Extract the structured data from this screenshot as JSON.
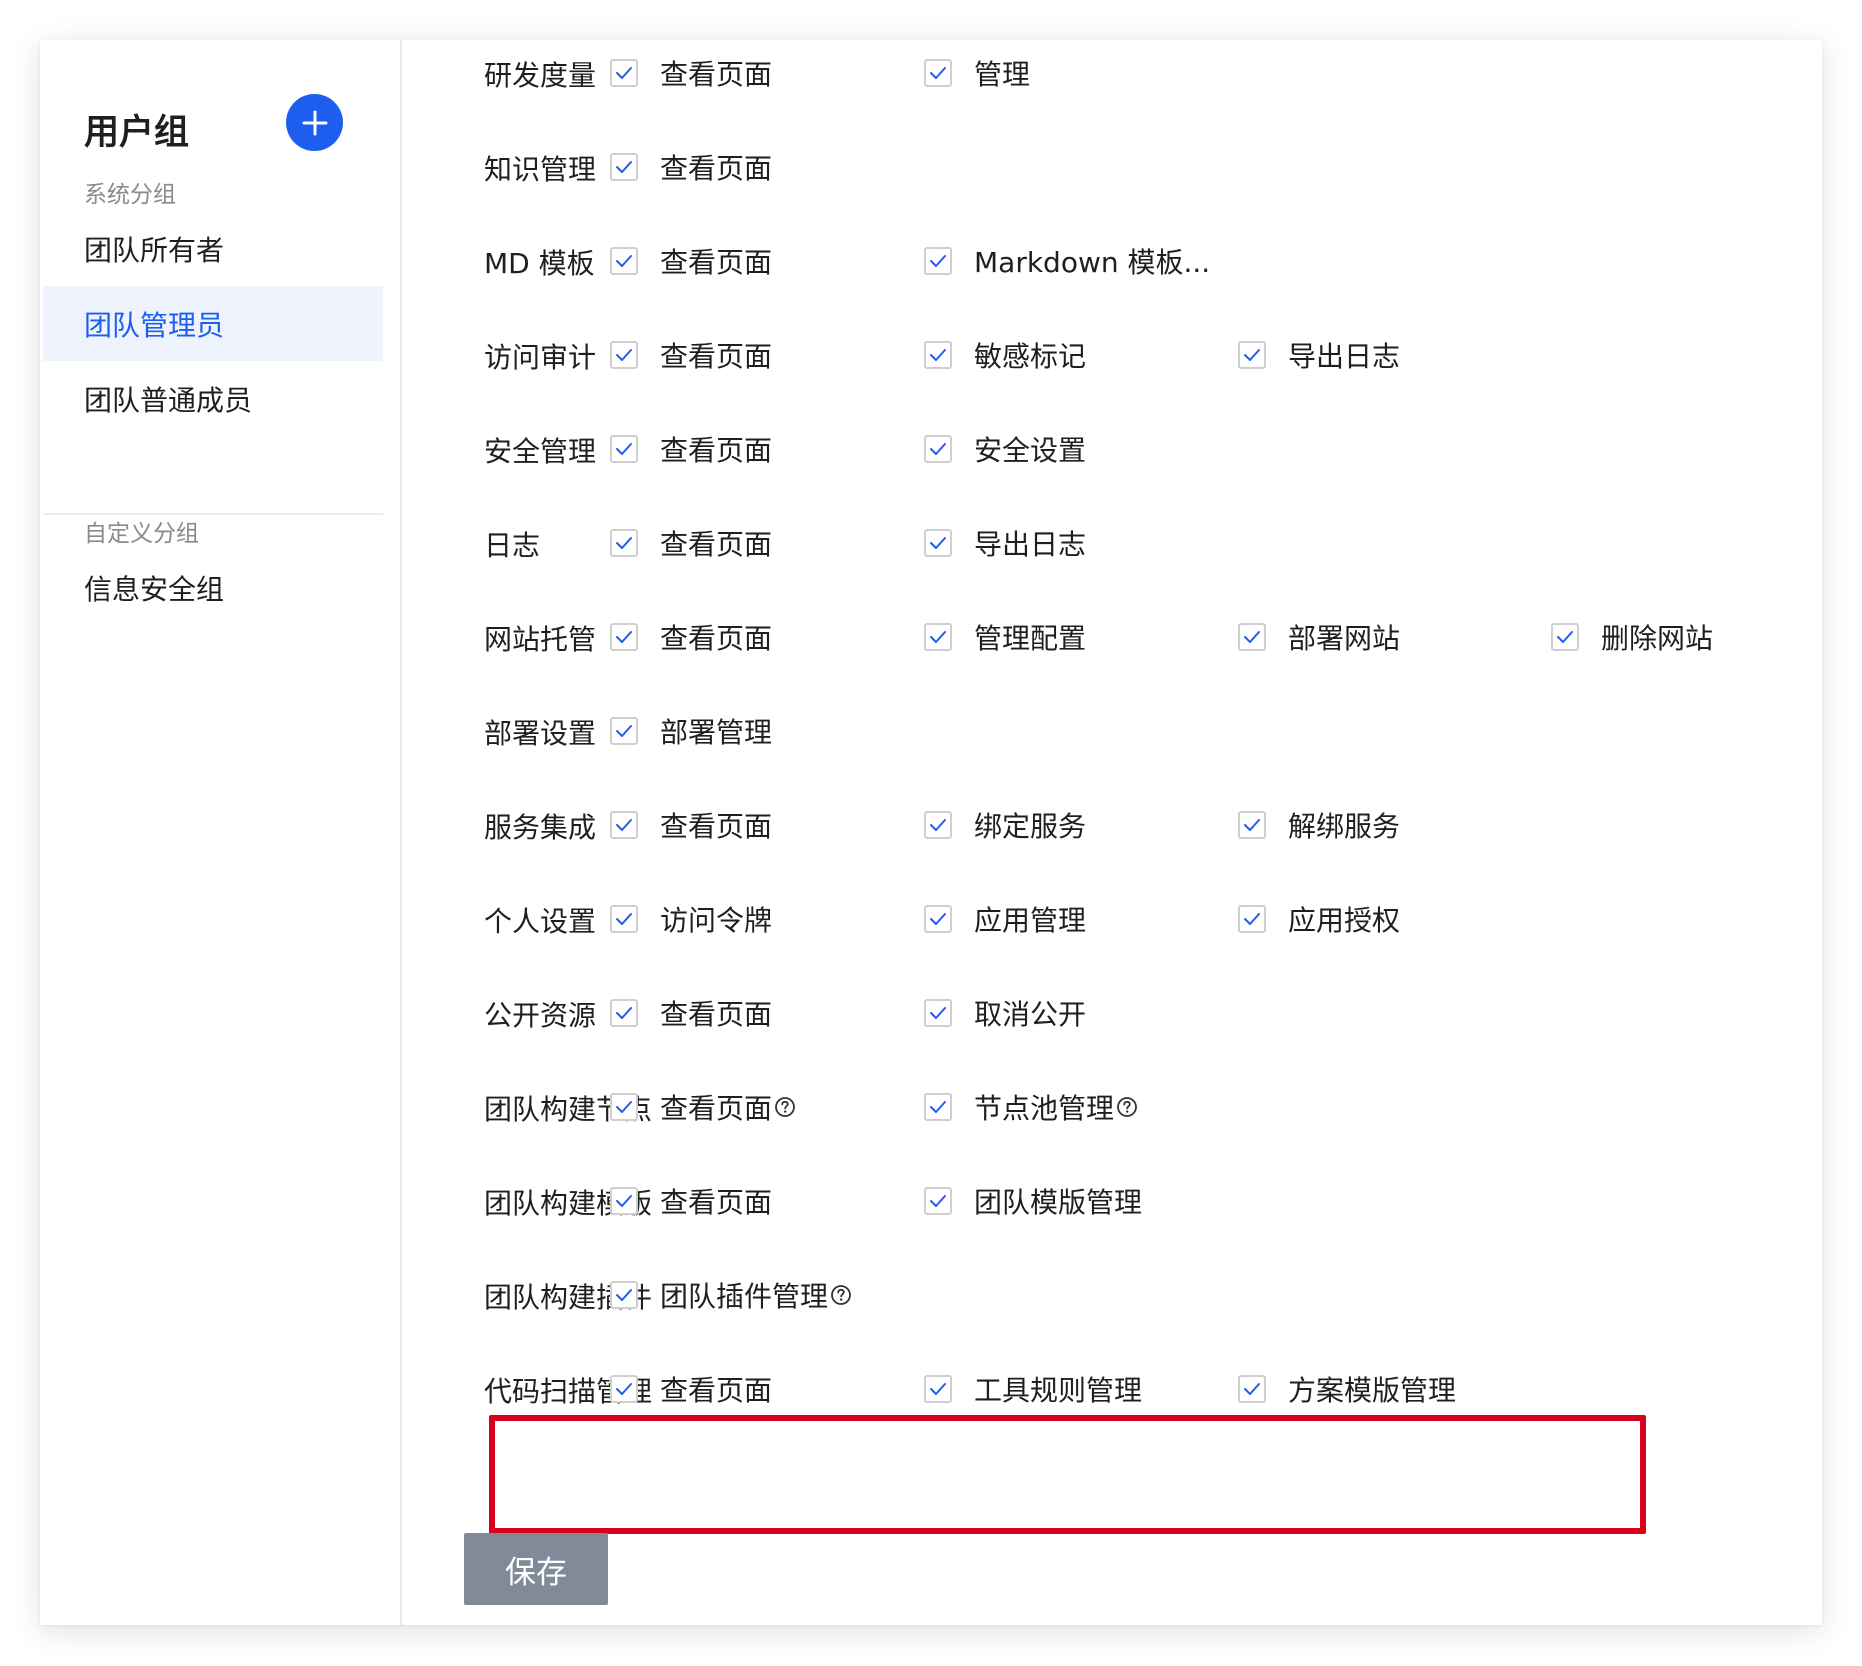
{
  "sidebar": {
    "title": "用户组",
    "system_group_label": "系统分组",
    "system_groups": [
      {
        "label": "团队所有者",
        "active": false
      },
      {
        "label": "团队管理员",
        "active": true
      },
      {
        "label": "团队普通成员",
        "active": false
      }
    ],
    "custom_group_label": "自定义分组",
    "custom_groups": [
      {
        "label": "信息安全组",
        "active": false
      }
    ]
  },
  "permissions": [
    {
      "category": "研发度量",
      "items": [
        {
          "label": "查看页面",
          "checked": true,
          "help": false
        },
        {
          "label": "管理",
          "checked": true,
          "help": false
        }
      ]
    },
    {
      "category": "知识管理",
      "items": [
        {
          "label": "查看页面",
          "checked": true,
          "help": false
        }
      ]
    },
    {
      "category": "MD 模板",
      "items": [
        {
          "label": "查看页面",
          "checked": true,
          "help": false
        },
        {
          "label": "Markdown 模板...",
          "checked": true,
          "help": false
        }
      ]
    },
    {
      "category": "访问审计",
      "items": [
        {
          "label": "查看页面",
          "checked": true,
          "help": false
        },
        {
          "label": "敏感标记",
          "checked": true,
          "help": false
        },
        {
          "label": "导出日志",
          "checked": true,
          "help": false
        }
      ]
    },
    {
      "category": "安全管理",
      "items": [
        {
          "label": "查看页面",
          "checked": true,
          "help": false
        },
        {
          "label": "安全设置",
          "checked": true,
          "help": false
        }
      ]
    },
    {
      "category": "日志",
      "items": [
        {
          "label": "查看页面",
          "checked": true,
          "help": false
        },
        {
          "label": "导出日志",
          "checked": true,
          "help": false
        }
      ]
    },
    {
      "category": "网站托管",
      "items": [
        {
          "label": "查看页面",
          "checked": true,
          "help": false
        },
        {
          "label": "管理配置",
          "checked": true,
          "help": false
        },
        {
          "label": "部署网站",
          "checked": true,
          "help": false
        },
        {
          "label": "删除网站",
          "checked": true,
          "help": false
        }
      ]
    },
    {
      "category": "部署设置",
      "items": [
        {
          "label": "部署管理",
          "checked": true,
          "help": false
        }
      ]
    },
    {
      "category": "服务集成",
      "items": [
        {
          "label": "查看页面",
          "checked": true,
          "help": false
        },
        {
          "label": "绑定服务",
          "checked": true,
          "help": false
        },
        {
          "label": "解绑服务",
          "checked": true,
          "help": false
        }
      ]
    },
    {
      "category": "个人设置",
      "items": [
        {
          "label": "访问令牌",
          "checked": true,
          "help": false
        },
        {
          "label": "应用管理",
          "checked": true,
          "help": false
        },
        {
          "label": "应用授权",
          "checked": true,
          "help": false
        }
      ]
    },
    {
      "category": "公开资源",
      "items": [
        {
          "label": "查看页面",
          "checked": true,
          "help": false
        },
        {
          "label": "取消公开",
          "checked": true,
          "help": false
        }
      ]
    },
    {
      "category": "团队构建节点",
      "items": [
        {
          "label": "查看页面",
          "checked": true,
          "help": true
        },
        {
          "label": "节点池管理",
          "checked": true,
          "help": true
        }
      ]
    },
    {
      "category": "团队构建模版",
      "items": [
        {
          "label": "查看页面",
          "checked": true,
          "help": false
        },
        {
          "label": "团队模版管理",
          "checked": true,
          "help": false
        }
      ]
    },
    {
      "category": "团队构建插件",
      "items": [
        {
          "label": "团队插件管理",
          "checked": true,
          "help": true
        }
      ]
    },
    {
      "category": "代码扫描管理",
      "items": [
        {
          "label": "查看页面",
          "checked": true,
          "help": false
        },
        {
          "label": "工具规则管理",
          "checked": true,
          "help": false
        },
        {
          "label": "方案模版管理",
          "checked": true,
          "help": false
        }
      ]
    }
  ],
  "save_label": "保存",
  "colors": {
    "accent": "#1d5ef0",
    "highlight_border": "#d9001b",
    "save_button": "#808a98",
    "active_bg": "#eef3fd"
  },
  "icons": {
    "add": "plus-icon",
    "check": "check-icon",
    "help": "help-circle-icon"
  }
}
